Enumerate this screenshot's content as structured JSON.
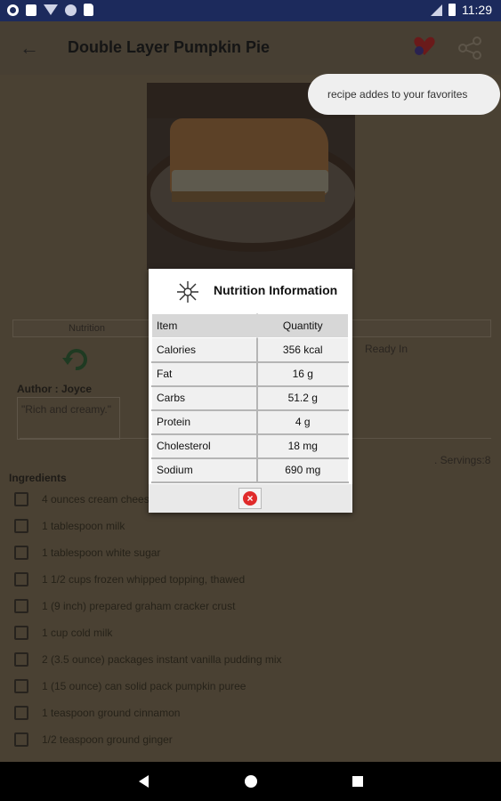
{
  "status_bar": {
    "time": "11:29"
  },
  "toolbar": {
    "title": "Double Layer Pumpkin Pie"
  },
  "toast": {
    "message": "recipe addes to your favorites"
  },
  "recipe": {
    "tab_label": "Nutrition",
    "ready_label": "Ready In",
    "author": "Author : Joyce",
    "description": "\"Rich and creamy.\"",
    "servings": ". Servings:8",
    "ingredients_title": "Ingredients",
    "ingredients": [
      "4 ounces cream cheese",
      "1 tablespoon milk",
      "1 tablespoon white sugar",
      "1 1/2 cups frozen whipped topping, thawed",
      "1 (9 inch) prepared graham cracker crust",
      "1 cup cold milk",
      "2 (3.5 ounce) packages instant vanilla pudding mix",
      "1 (15 ounce) can solid pack pumpkin puree",
      "1 teaspoon ground cinnamon",
      "1/2 teaspoon ground ginger"
    ]
  },
  "dialog": {
    "title": "Nutrition Information",
    "header": {
      "item": "Item",
      "quantity": "Quantity"
    },
    "rows": [
      {
        "item": "Calories",
        "quantity": "356 kcal"
      },
      {
        "item": "Fat",
        "quantity": "16 g"
      },
      {
        "item": "Carbs",
        "quantity": "51.2 g"
      },
      {
        "item": "Protein",
        "quantity": "4 g"
      },
      {
        "item": "Cholesterol",
        "quantity": "18 mg"
      },
      {
        "item": "Sodium",
        "quantity": "690 mg"
      }
    ]
  }
}
